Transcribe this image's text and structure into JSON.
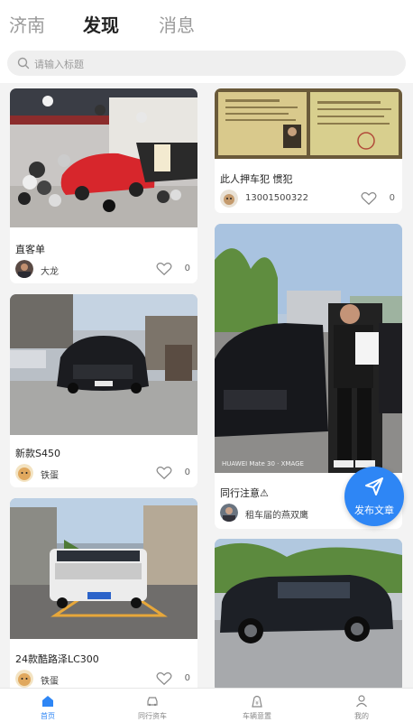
{
  "top_tabs": [
    "济南",
    "发现",
    "消息"
  ],
  "search": {
    "placeholder": "请输入标题"
  },
  "cards": [
    {
      "title": "直客单",
      "author": "大龙",
      "likes": "0"
    },
    {
      "title": "此人押车犯 惯犯",
      "author": "13001500322",
      "likes": "0"
    },
    {
      "title": "新款S450",
      "author": "铁蛋",
      "likes": "0"
    },
    {
      "title": "同行注意⚠",
      "author": "租车届的燕双鹰",
      "likes": ""
    },
    {
      "title": "24款酷路泽LC300",
      "author": "铁蛋",
      "likes": "0"
    }
  ],
  "photo_watermark": "HUAWEI Mate 30 · XMAGE",
  "fab": {
    "label": "发布文章"
  },
  "nav": [
    "首页",
    "同行资车",
    "车辆意置",
    "我的"
  ],
  "colors": {
    "accent": "#2e86f5"
  },
  "icons": [
    "search-icon",
    "heart-icon",
    "paper-plane-icon",
    "home-icon",
    "car-icon",
    "bag-icon",
    "user-icon"
  ]
}
